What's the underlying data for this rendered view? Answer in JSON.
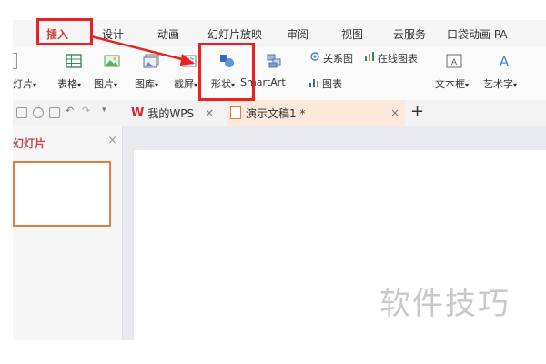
{
  "menubar": {
    "items": [
      "插入",
      "设计",
      "动画",
      "幻灯片放映",
      "审阅",
      "视图",
      "云服务",
      "口袋动画 PA"
    ]
  },
  "ribbon": {
    "labels": {
      "new_slide": "灯片",
      "table": "表格",
      "picture": "图片",
      "gallery": "图库",
      "screenshot": "截屏",
      "shape": "形状",
      "smartart": "SmartArt",
      "chart": "图表",
      "relation": "关系图",
      "online_chart": "在线图表",
      "textbox": "文本框",
      "wordart": "艺术字"
    },
    "dropdown_marker": "▾",
    "icons": {
      "table": "table-icon",
      "picture": "picture-icon",
      "gallery": "gallery-icon",
      "screenshot": "screenshot-icon",
      "shape": "shape-icon",
      "smartart": "smartart-icon",
      "relation": "relation-icon",
      "online_chart": "online-chart-icon",
      "textbox": "textbox-icon",
      "wordart": "wordart-icon"
    }
  },
  "tabs": {
    "items": [
      {
        "label": "我的WPS",
        "icon": "wps-logo-icon"
      },
      {
        "label": "演示文稿1 *",
        "icon": "presentation-file-icon"
      }
    ],
    "close": "×",
    "add": "+"
  },
  "panel": {
    "title": "幻灯片",
    "close": "×"
  },
  "watermark": "软件技巧",
  "colors": {
    "highlight": "#e62222",
    "accent": "#e97a3b",
    "active_tab_bg": "#fde9dc",
    "wps_red": "#d7282f"
  }
}
